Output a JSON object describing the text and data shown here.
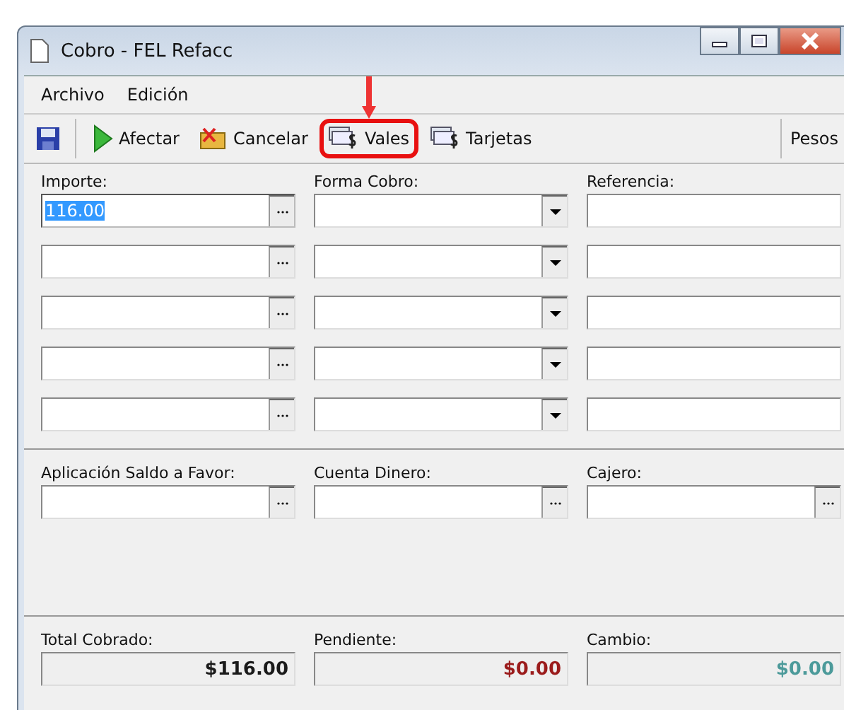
{
  "window": {
    "title": "Cobro - FEL Refacc"
  },
  "menu": [
    "Archivo",
    "Edición"
  ],
  "toolbar": [
    {
      "kind": "save",
      "highlighted": false
    },
    {
      "kind": "play",
      "label": "Afectar",
      "highlighted": false
    },
    {
      "kind": "cancel",
      "label": "Cancelar",
      "highlighted": false
    },
    {
      "kind": "money",
      "label": "Vales",
      "highlighted": true
    },
    {
      "kind": "money",
      "label": "Tarjetas",
      "highlighted": false
    }
  ],
  "currency": "Pesos",
  "payments": {
    "columns": [
      "Importe:",
      "Forma Cobro:",
      "Referencia:"
    ],
    "rows": [
      {
        "importe": "116.00",
        "selected": true
      },
      {
        "selected": false
      },
      {
        "selected": false
      },
      {
        "selected": false
      },
      {
        "selected": false
      }
    ]
  },
  "extra_fields": [
    {
      "label": "Aplicación Saldo a Favor:"
    },
    {
      "label": "Cuenta Dinero:"
    },
    {
      "label": "Cajero:"
    }
  ],
  "totals": [
    {
      "label": "Total Cobrado:",
      "value": "$116.00",
      "color": "#1a1a1a"
    },
    {
      "label": "Pendiente:",
      "value": "$0.00",
      "color": "#9b1c1c"
    },
    {
      "label": "Cambio:",
      "value": "$0.00",
      "color": "#4c9a9a"
    }
  ]
}
